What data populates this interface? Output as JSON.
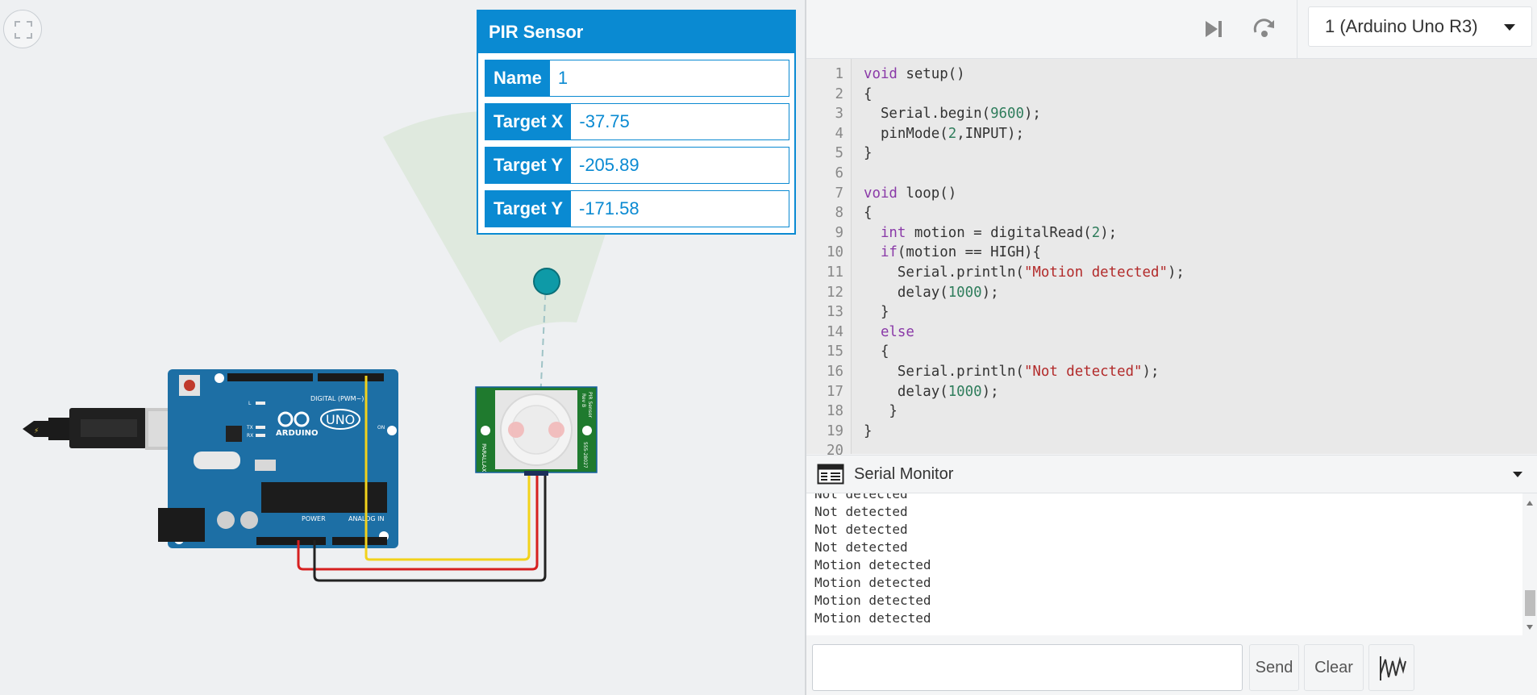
{
  "pir_panel": {
    "title": "PIR Sensor",
    "properties": [
      {
        "label": "Name",
        "value": "1"
      },
      {
        "label": "Target X",
        "value": "-37.75"
      },
      {
        "label": "Target Y",
        "value": "-205.89"
      },
      {
        "label": "Target Y",
        "value": "-171.58"
      }
    ]
  },
  "board": {
    "brand": "ARDUINO",
    "model": "UNO",
    "header_digital": "DIGITAL (PWM~)",
    "header_power": "POWER",
    "header_analog": "ANALOG IN",
    "led_on": "ON",
    "led_l": "L",
    "led_tx": "TX",
    "led_rx": "RX"
  },
  "sensor": {
    "brand": "PARALLAX",
    "name": "PIR Sensor",
    "rev": "Rev B",
    "part": "555-28027"
  },
  "wires": {
    "signal_color": "#f2d21b",
    "power_color": "#d62020",
    "ground_color": "#222222"
  },
  "toolbar": {
    "device_selected": "1 (Arduino Uno R3)",
    "play_icon": "step-play-icon",
    "restart_icon": "restart-icon"
  },
  "code": {
    "lines": [
      "void setup()",
      "{",
      "  Serial.begin(9600);",
      "  pinMode(2,INPUT);",
      "}",
      "",
      "void loop()",
      "{",
      "  int motion = digitalRead(2);",
      "  if(motion == HIGH){",
      "    Serial.println(\"Motion detected\");",
      "    delay(1000);",
      "  }",
      "  else",
      "  {",
      "    Serial.println(\"Not detected\");",
      "    delay(1000);",
      "   }",
      "}",
      ""
    ]
  },
  "serial_monitor": {
    "title": "Serial Monitor",
    "lines": [
      "Not detected",
      "Not detected",
      "Not detected",
      "Not detected",
      "Motion detected",
      "Motion detected",
      "Motion detected",
      "Motion detected"
    ],
    "input_value": "",
    "send_label": "Send",
    "clear_label": "Clear",
    "graph_icon": "graph-icon"
  },
  "colors": {
    "accent": "#0a8ad2",
    "board": "#1d6fa5",
    "sensor_pcb": "#1f7a2e",
    "target_dot": "#0e9aa7"
  }
}
